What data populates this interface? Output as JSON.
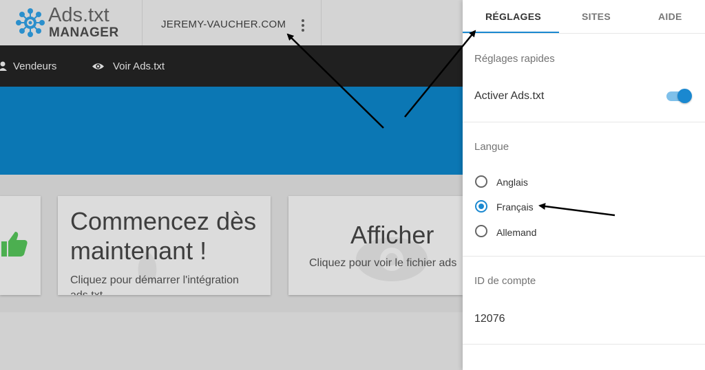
{
  "app": {
    "logo_title": "Ads.txt",
    "logo_subtitle": "MANAGER",
    "site_name": "JEREMY-VAUCHER.COM"
  },
  "nav": {
    "items": [
      {
        "label": "Vendeurs",
        "icon": "person-icon"
      },
      {
        "label": "Voir Ads.txt",
        "icon": "eye-icon"
      }
    ]
  },
  "cards": {
    "start": {
      "title_line1": "Commencez dès",
      "title_line2": "maintenant !",
      "subtitle_line1": "Cliquez pour démarrer l'intégration",
      "subtitle_line2": "ads.txt"
    },
    "view": {
      "title": "Afficher",
      "subtitle": "Cliquez pour voir le fichier ads"
    }
  },
  "panel": {
    "tabs": [
      {
        "label": "RÉGLAGES",
        "active": true
      },
      {
        "label": "SITES",
        "active": false
      },
      {
        "label": "AIDE",
        "active": false
      }
    ],
    "quick_settings": {
      "heading": "Réglages rapides",
      "toggle_label": "Activer Ads.txt",
      "toggle_on": true
    },
    "language": {
      "heading": "Langue",
      "options": [
        {
          "label": "Anglais",
          "checked": false
        },
        {
          "label": "Français",
          "checked": true
        },
        {
          "label": "Allemand",
          "checked": false
        }
      ]
    },
    "account": {
      "heading": "ID de compte",
      "value": "12076"
    }
  },
  "colors": {
    "accent": "#1a88d0",
    "hero": "#0b77b4",
    "navbar": "#202020",
    "thumb_green": "#4caf50"
  }
}
